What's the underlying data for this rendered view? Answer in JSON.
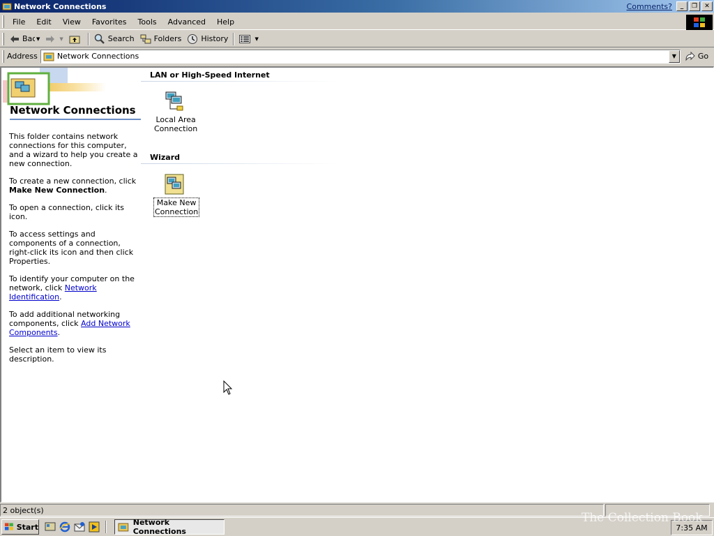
{
  "window": {
    "title": "Network Connections",
    "comments_link": "Comments?",
    "controls": [
      "minimize",
      "restore",
      "close"
    ]
  },
  "menubar": {
    "items": [
      "File",
      "Edit",
      "View",
      "Favorites",
      "Tools",
      "Advanced",
      "Help"
    ]
  },
  "toolbar": {
    "back": "Back",
    "search": "Search",
    "folders": "Folders",
    "history": "History"
  },
  "address": {
    "label": "Address",
    "value": "Network Connections",
    "go": "Go"
  },
  "left_panel": {
    "title": "Network Connections",
    "para1": "This folder contains network connections for this computer, and a wizard to help you create a new connection.",
    "para2_prefix": "To create a new connection, click",
    "para2_bold": "Make New Connection",
    "para2_suffix": ".",
    "para3": "To open a connection, click its icon.",
    "para4": "To access settings and components of a connection, right-click its icon and then click Properties.",
    "para5_prefix": "To identify your computer on the network, click",
    "para5_link": "Network Identification",
    "para5_suffix": ".",
    "para6_prefix": "To add additional networking components, click",
    "para6_link": "Add Network Components",
    "para6_suffix": ".",
    "para7": "Select an item to view its description."
  },
  "groups": [
    {
      "header": "LAN or High-Speed Internet",
      "items": [
        {
          "label": "Local Area Connection",
          "icon": "lan-connection-icon",
          "selected": false
        }
      ]
    },
    {
      "header": "Wizard",
      "items": [
        {
          "label": "Make New Connection",
          "icon": "make-new-connection-icon",
          "selected": true
        }
      ]
    }
  ],
  "statusbar": {
    "objects": "2 object(s)"
  },
  "taskbar": {
    "start": "Start",
    "task": "Network Connections",
    "clock": "7:35 AM",
    "watermark": "The Collection Book"
  },
  "colors": {
    "title_gradient_start": "#0a246a",
    "title_gradient_end": "#a6caf0",
    "face": "#d4d0c8",
    "link": "#0000cc"
  }
}
